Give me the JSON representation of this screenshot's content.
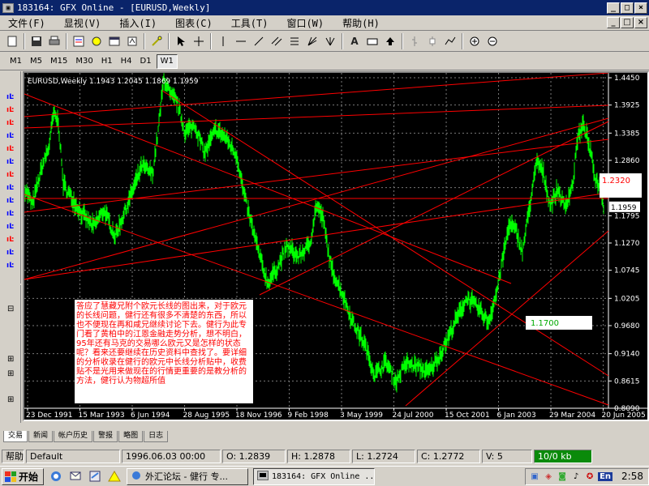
{
  "window": {
    "title": "183164: GFX Online - [EURUSD,Weekly]",
    "minimize": "_",
    "maximize": "□",
    "close": "×"
  },
  "menu": {
    "items": [
      "文件(F)",
      "显视(V)",
      "插入(I)",
      "图表(C)",
      "工具(T)",
      "窗口(W)",
      "帮助(H)"
    ]
  },
  "toolbar": {
    "icons": [
      "new-chart-icon",
      "save-icon",
      "print-icon",
      "market-watch-icon",
      "navigator-icon",
      "terminal-icon",
      "expert-advisor-icon",
      "cursor-icon",
      "crosshair-icon",
      "vertical-line-icon",
      "horizontal-line-icon",
      "trendline-icon",
      "channel-icon",
      "fibonacci-icon",
      "gann-icon",
      "text-icon",
      "label-icon",
      "arrow-icon",
      "bar-chart-icon",
      "candle-chart-icon",
      "line-chart-icon",
      "zoom-in-icon",
      "zoom-out-icon"
    ]
  },
  "timeframes": {
    "items": [
      "M1",
      "M5",
      "M15",
      "M30",
      "H1",
      "H4",
      "D1",
      "W1"
    ],
    "active": "W1"
  },
  "chart": {
    "header": "EURUSD,Weekly  1.1943 1.2045 1.1869 1.1959",
    "price_axis": [
      "1.4450",
      "1.3925",
      "1.3385",
      "1.2860",
      "1.2335",
      "1.1795",
      "1.1270",
      "1.0745",
      "1.0205",
      "0.9680",
      "0.9140",
      "0.8615",
      "0.8090"
    ],
    "date_axis": [
      "23 Dec 1991",
      "15 Mar 1993",
      "6 Jun 1994",
      "28 Aug 1995",
      "18 Nov 1996",
      "9 Feb 1998",
      "3 May 1999",
      "24 Jul 2000",
      "15 Oct 2001",
      "6 Jan 2003",
      "29 Mar 2004",
      "20 Jun 2005"
    ],
    "current_price": "1.1959",
    "label_high": "1.2320",
    "label_low": "1.1700",
    "note": "答应了慧藏兄附个欧元长线的图出来，对于欧元的长线问题，健行还有很多不清楚的东西，所以也不便现在再和咸兄继续讨论下去。健行为此专门看了黄柏中的江恩金融走势分析，想不明白，95年还有马克的交易哪么欧元又是怎样的状态呢？看来还要继续在历史资料中查找了。要详细的分析收录在健行的欧元中长线分析贴中，收费贴不是光用来做现在的行情更重要的是教分析的方法，健行认为物超所值",
    "colors": {
      "background": "#000000",
      "price": "#00ff00",
      "lines": "#ff0000",
      "grid": "#7a7a7a",
      "text": "#ffffff"
    }
  },
  "tabs": {
    "items": [
      "交易",
      "新闻",
      "帐户历史",
      "警报",
      "略图",
      "日志"
    ],
    "active": "交易"
  },
  "status": {
    "help": "帮助",
    "profile": "Default",
    "datetime": "1996.06.03 00:00",
    "open": "O: 1.2839",
    "high": "H: 1.2878",
    "low": "L: 1.2724",
    "close": "C: 1.2772",
    "volume": "V: 5",
    "traffic": "10/0 kb"
  },
  "taskbar": {
    "start": "开始",
    "tasks": [
      "外汇论坛 - 健行 专...",
      "183164: GFX Online ..."
    ],
    "lang": "En",
    "clock": "2:58"
  }
}
